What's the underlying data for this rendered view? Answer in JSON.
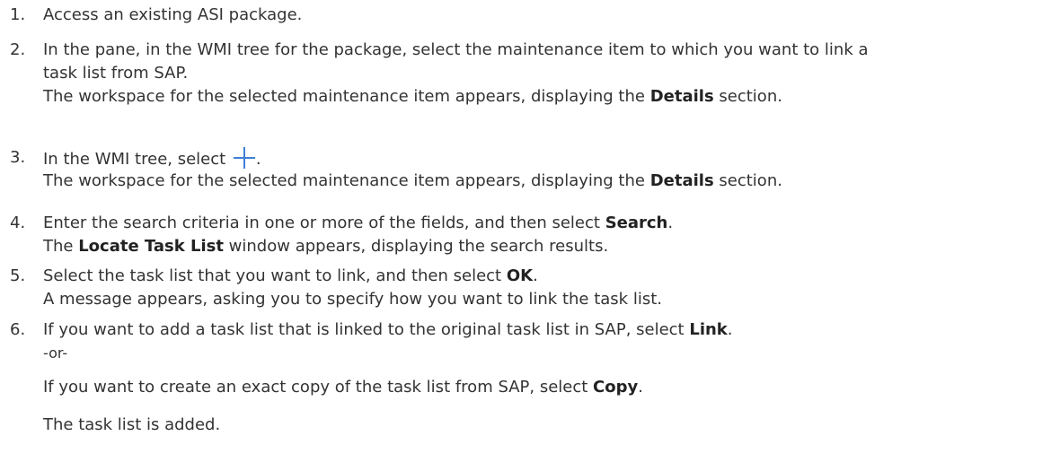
{
  "steps": [
    {
      "number": "1.",
      "text": "Access an existing ASI package."
    },
    {
      "number": "2.",
      "line1": "In the pane, in the WMI tree for the package, select the maintenance item to which you want to link a",
      "line2": "task list from SAP.",
      "result_pre": "The workspace for the selected maintenance item appears, displaying the ",
      "result_bold": "Details",
      "result_post": " section."
    },
    {
      "number": "3.",
      "text_pre": "In the WMI tree, select ",
      "text_post": ".",
      "icon": "plus-icon",
      "icon_color": "#3d7fd8",
      "result_pre": "The workspace for the selected maintenance item appears, displaying the ",
      "result_bold": "Details",
      "result_post": " section."
    },
    {
      "number": "4.",
      "text_pre": "Enter the search criteria in one or more of the fields, and then select ",
      "text_bold": "Search",
      "text_post": ".",
      "result_pre": "The ",
      "result_bold": "Locate Task List",
      "result_post": " window appears, displaying the search results."
    },
    {
      "number": "5.",
      "text_pre": "Select the task list that you want to link, and then select ",
      "text_bold": "OK",
      "text_post": ".",
      "result": "A message appears, asking you to specify how you want to link the task list."
    },
    {
      "number": "6.",
      "text_pre": "If you want to add a task list that is linked to the original task list in SAP, select ",
      "text_bold": "Link",
      "text_post": ".",
      "or": "-or-",
      "alt_pre": "If you want to create an exact copy of the task list from SAP, select ",
      "alt_bold": "Copy",
      "alt_post": ".",
      "final": "The task list is added."
    }
  ]
}
